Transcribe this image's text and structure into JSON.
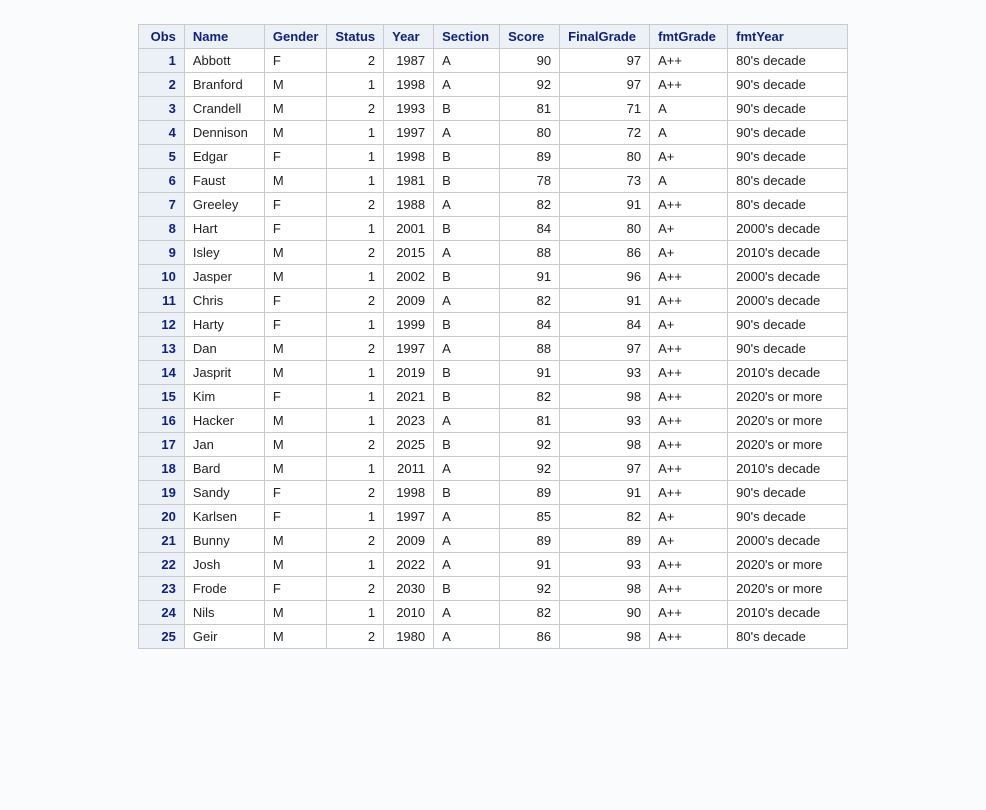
{
  "table": {
    "headers": [
      "Obs",
      "Name",
      "Gender",
      "Status",
      "Year",
      "Section",
      "Score",
      "FinalGrade",
      "fmtGrade",
      "fmtYear"
    ],
    "rows": [
      {
        "obs": 1,
        "name": "Abbott",
        "gender": "F",
        "status": 2,
        "year": 1987,
        "section": "A",
        "score": 90,
        "finalgrade": 97,
        "fmtgrade": "A++",
        "fmtyear": "80's decade"
      },
      {
        "obs": 2,
        "name": "Branford",
        "gender": "M",
        "status": 1,
        "year": 1998,
        "section": "A",
        "score": 92,
        "finalgrade": 97,
        "fmtgrade": "A++",
        "fmtyear": "90's decade"
      },
      {
        "obs": 3,
        "name": "Crandell",
        "gender": "M",
        "status": 2,
        "year": 1993,
        "section": "B",
        "score": 81,
        "finalgrade": 71,
        "fmtgrade": "A",
        "fmtyear": "90's decade"
      },
      {
        "obs": 4,
        "name": "Dennison",
        "gender": "M",
        "status": 1,
        "year": 1997,
        "section": "A",
        "score": 80,
        "finalgrade": 72,
        "fmtgrade": "A",
        "fmtyear": "90's decade"
      },
      {
        "obs": 5,
        "name": "Edgar",
        "gender": "F",
        "status": 1,
        "year": 1998,
        "section": "B",
        "score": 89,
        "finalgrade": 80,
        "fmtgrade": "A+",
        "fmtyear": "90's decade"
      },
      {
        "obs": 6,
        "name": "Faust",
        "gender": "M",
        "status": 1,
        "year": 1981,
        "section": "B",
        "score": 78,
        "finalgrade": 73,
        "fmtgrade": "A",
        "fmtyear": "80's decade"
      },
      {
        "obs": 7,
        "name": "Greeley",
        "gender": "F",
        "status": 2,
        "year": 1988,
        "section": "A",
        "score": 82,
        "finalgrade": 91,
        "fmtgrade": "A++",
        "fmtyear": "80's decade"
      },
      {
        "obs": 8,
        "name": "Hart",
        "gender": "F",
        "status": 1,
        "year": 2001,
        "section": "B",
        "score": 84,
        "finalgrade": 80,
        "fmtgrade": "A+",
        "fmtyear": "2000's decade"
      },
      {
        "obs": 9,
        "name": "Isley",
        "gender": "M",
        "status": 2,
        "year": 2015,
        "section": "A",
        "score": 88,
        "finalgrade": 86,
        "fmtgrade": "A+",
        "fmtyear": "2010's decade"
      },
      {
        "obs": 10,
        "name": "Jasper",
        "gender": "M",
        "status": 1,
        "year": 2002,
        "section": "B",
        "score": 91,
        "finalgrade": 96,
        "fmtgrade": "A++",
        "fmtyear": "2000's decade"
      },
      {
        "obs": 11,
        "name": "Chris",
        "gender": "F",
        "status": 2,
        "year": 2009,
        "section": "A",
        "score": 82,
        "finalgrade": 91,
        "fmtgrade": "A++",
        "fmtyear": "2000's decade"
      },
      {
        "obs": 12,
        "name": "Harty",
        "gender": "F",
        "status": 1,
        "year": 1999,
        "section": "B",
        "score": 84,
        "finalgrade": 84,
        "fmtgrade": "A+",
        "fmtyear": "90's decade"
      },
      {
        "obs": 13,
        "name": "Dan",
        "gender": "M",
        "status": 2,
        "year": 1997,
        "section": "A",
        "score": 88,
        "finalgrade": 97,
        "fmtgrade": "A++",
        "fmtyear": "90's decade"
      },
      {
        "obs": 14,
        "name": "Jasprit",
        "gender": "M",
        "status": 1,
        "year": 2019,
        "section": "B",
        "score": 91,
        "finalgrade": 93,
        "fmtgrade": "A++",
        "fmtyear": "2010's decade"
      },
      {
        "obs": 15,
        "name": "Kim",
        "gender": "F",
        "status": 1,
        "year": 2021,
        "section": "B",
        "score": 82,
        "finalgrade": 98,
        "fmtgrade": "A++",
        "fmtyear": "2020's or more"
      },
      {
        "obs": 16,
        "name": "Hacker",
        "gender": "M",
        "status": 1,
        "year": 2023,
        "section": "A",
        "score": 81,
        "finalgrade": 93,
        "fmtgrade": "A++",
        "fmtyear": "2020's or more"
      },
      {
        "obs": 17,
        "name": "Jan",
        "gender": "M",
        "status": 2,
        "year": 2025,
        "section": "B",
        "score": 92,
        "finalgrade": 98,
        "fmtgrade": "A++",
        "fmtyear": "2020's or more"
      },
      {
        "obs": 18,
        "name": "Bard",
        "gender": "M",
        "status": 1,
        "year": 2011,
        "section": "A",
        "score": 92,
        "finalgrade": 97,
        "fmtgrade": "A++",
        "fmtyear": "2010's decade"
      },
      {
        "obs": 19,
        "name": "Sandy",
        "gender": "F",
        "status": 2,
        "year": 1998,
        "section": "B",
        "score": 89,
        "finalgrade": 91,
        "fmtgrade": "A++",
        "fmtyear": "90's decade"
      },
      {
        "obs": 20,
        "name": "Karlsen",
        "gender": "F",
        "status": 1,
        "year": 1997,
        "section": "A",
        "score": 85,
        "finalgrade": 82,
        "fmtgrade": "A+",
        "fmtyear": "90's decade"
      },
      {
        "obs": 21,
        "name": "Bunny",
        "gender": "M",
        "status": 2,
        "year": 2009,
        "section": "A",
        "score": 89,
        "finalgrade": 89,
        "fmtgrade": "A+",
        "fmtyear": "2000's decade"
      },
      {
        "obs": 22,
        "name": "Josh",
        "gender": "M",
        "status": 1,
        "year": 2022,
        "section": "A",
        "score": 91,
        "finalgrade": 93,
        "fmtgrade": "A++",
        "fmtyear": "2020's or more"
      },
      {
        "obs": 23,
        "name": "Frode",
        "gender": "F",
        "status": 2,
        "year": 2030,
        "section": "B",
        "score": 92,
        "finalgrade": 98,
        "fmtgrade": "A++",
        "fmtyear": "2020's or more"
      },
      {
        "obs": 24,
        "name": "Nils",
        "gender": "M",
        "status": 1,
        "year": 2010,
        "section": "A",
        "score": 82,
        "finalgrade": 90,
        "fmtgrade": "A++",
        "fmtyear": "2010's decade"
      },
      {
        "obs": 25,
        "name": "Geir",
        "gender": "M",
        "status": 2,
        "year": 1980,
        "section": "A",
        "score": 86,
        "finalgrade": 98,
        "fmtgrade": "A++",
        "fmtyear": "80's decade"
      }
    ]
  }
}
